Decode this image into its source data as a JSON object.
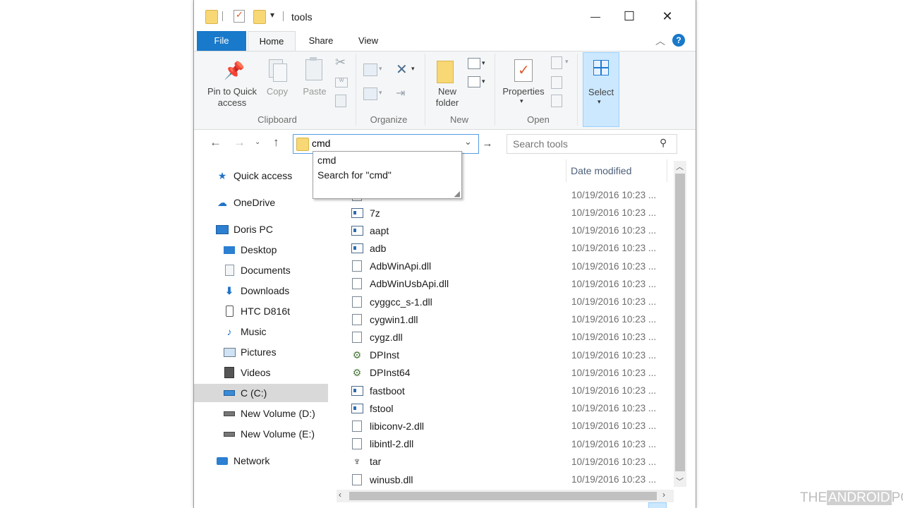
{
  "window": {
    "title": "tools",
    "controls": {
      "minimize": "—",
      "maximize": "☐",
      "close": "✕"
    }
  },
  "tabs": [
    {
      "label": "File"
    },
    {
      "label": "Home"
    },
    {
      "label": "Share"
    },
    {
      "label": "View"
    }
  ],
  "ribbon": {
    "clipboard": {
      "group_label": "Clipboard",
      "pin": "Pin to Quick access",
      "pin_line1": "Pin to Quick",
      "pin_line2": "access",
      "copy": "Copy",
      "paste": "Paste"
    },
    "organize": {
      "group_label": "Organize"
    },
    "new": {
      "group_label": "New",
      "line1": "New",
      "line2": "folder"
    },
    "open": {
      "group_label": "Open",
      "properties": "Properties"
    },
    "select": {
      "label": "Select"
    }
  },
  "address": {
    "value": "cmd",
    "suggestions": [
      "cmd",
      "Search for \"cmd\""
    ]
  },
  "search": {
    "placeholder": "Search tools"
  },
  "nav": {
    "quick_access": "Quick access",
    "onedrive": "OneDrive",
    "this_pc": "Doris PC",
    "items": [
      {
        "label": "Desktop",
        "icon": "desktop-icon"
      },
      {
        "label": "Documents",
        "icon": "documents-icon"
      },
      {
        "label": "Downloads",
        "icon": "downloads-icon"
      },
      {
        "label": "HTC D816t",
        "icon": "phone-icon"
      },
      {
        "label": "Music",
        "icon": "music-icon"
      },
      {
        "label": "Pictures",
        "icon": "pictures-icon"
      },
      {
        "label": "Videos",
        "icon": "videos-icon"
      },
      {
        "label": "C (C:)",
        "icon": "drive-icon",
        "selected": true
      },
      {
        "label": "New Volume (D:)",
        "icon": "drive-icon"
      },
      {
        "label": "New Volume (E:)",
        "icon": "drive-icon"
      }
    ],
    "network": "Network"
  },
  "columns": {
    "date_modified": "Date modified"
  },
  "files": [
    {
      "name": "7z",
      "date": "10/19/2016 10:23 ...",
      "type": "app"
    },
    {
      "name": "aapt",
      "date": "10/19/2016 10:23 ...",
      "type": "app"
    },
    {
      "name": "adb",
      "date": "10/19/2016 10:23 ...",
      "type": "app"
    },
    {
      "name": "AdbWinApi.dll",
      "date": "10/19/2016 10:23 ...",
      "type": "dll"
    },
    {
      "name": "AdbWinUsbApi.dll",
      "date": "10/19/2016 10:23 ...",
      "type": "dll"
    },
    {
      "name": "cyggcc_s-1.dll",
      "date": "10/19/2016 10:23 ...",
      "type": "dll"
    },
    {
      "name": "cygwin1.dll",
      "date": "10/19/2016 10:23 ...",
      "type": "dll"
    },
    {
      "name": "cygz.dll",
      "date": "10/19/2016 10:23 ...",
      "type": "dll"
    },
    {
      "name": "DPInst",
      "date": "10/19/2016 10:23 ...",
      "type": "installer"
    },
    {
      "name": "DPInst64",
      "date": "10/19/2016 10:23 ...",
      "type": "installer"
    },
    {
      "name": "fastboot",
      "date": "10/19/2016 10:23 ...",
      "type": "app"
    },
    {
      "name": "fstool",
      "date": "10/19/2016 10:23 ...",
      "type": "app"
    },
    {
      "name": "libiconv-2.dll",
      "date": "10/19/2016 10:23 ...",
      "type": "dll"
    },
    {
      "name": "libintl-2.dll",
      "date": "10/19/2016 10:23 ...",
      "type": "dll"
    },
    {
      "name": "tar",
      "date": "10/19/2016 10:23 ...",
      "type": "gnu"
    },
    {
      "name": "winusb.dll",
      "date": "10/19/2016 10:23 ...",
      "type": "dll"
    }
  ],
  "partial_row_date": "10/19/2016 10:23 ...",
  "watermark": {
    "part1": "THE",
    "part2": "ANDROID",
    "part3": "PORTAL"
  },
  "colors": {
    "accent": "#1979ca",
    "selection": "#cce8ff",
    "folder": "#f8d775"
  }
}
